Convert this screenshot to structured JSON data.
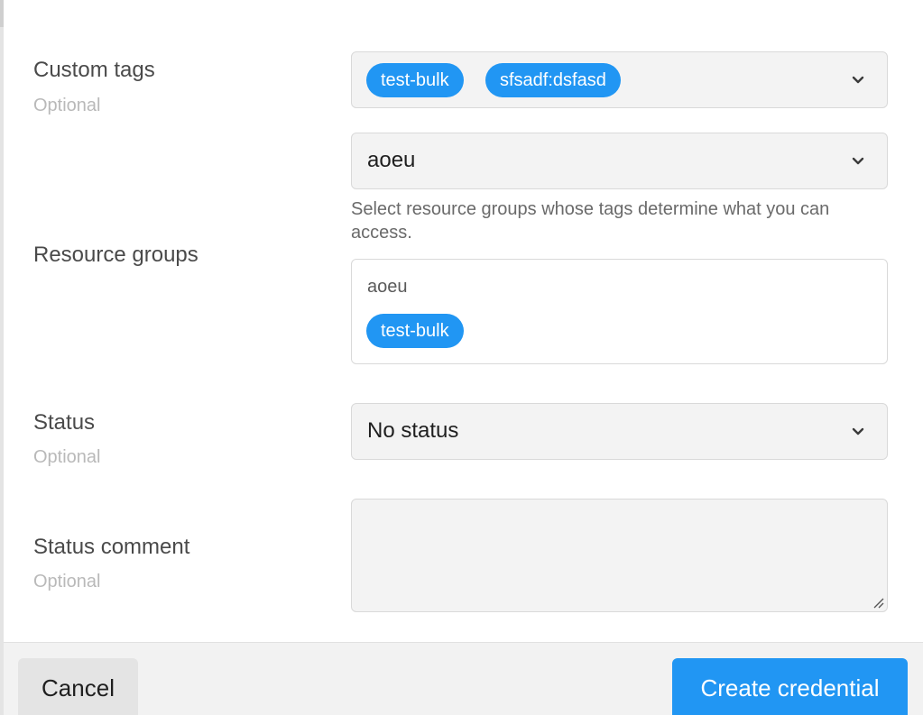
{
  "form": {
    "custom_tags": {
      "label": "Custom tags",
      "sub": "Optional",
      "chips": [
        "test-bulk",
        "sfsadf:dsfasd"
      ]
    },
    "resource_groups": {
      "label": "Resource groups",
      "selected": "aoeu",
      "help": "Select resource groups whose tags determine what you can access.",
      "preview_title": "aoeu",
      "preview_chip": "test-bulk"
    },
    "status": {
      "label": "Status",
      "sub": "Optional",
      "selected": "No status"
    },
    "status_comment": {
      "label": "Status comment",
      "sub": "Optional",
      "value": ""
    }
  },
  "footer": {
    "cancel_label": "Cancel",
    "create_label": "Create credential"
  },
  "colors": {
    "accent": "#2196f3",
    "field_bg": "#f3f3f3",
    "border": "#d9d9d9"
  },
  "icons": {
    "dropdown": "chevron-down-icon",
    "resize": "resize-grip-icon"
  }
}
